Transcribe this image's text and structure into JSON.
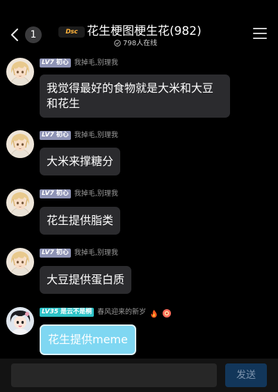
{
  "header": {
    "unread_count": "1",
    "logo_text": "Dsc one!",
    "title": "花生梗图梗生花(982)",
    "online_text": "798人在线"
  },
  "messages": [
    {
      "level": "LV7",
      "rank": "初心",
      "nickname": "我掉毛,别理我",
      "text": "我觉得最好的食物就是大米和大豆和花生"
    },
    {
      "level": "LV7",
      "rank": "初心",
      "nickname": "我掉毛,别理我",
      "text": "大米来撑糖分"
    },
    {
      "level": "LV7",
      "rank": "初心",
      "nickname": "我掉毛,别理我",
      "text": "花生提供脂类"
    },
    {
      "level": "LV7",
      "rank": "初心",
      "nickname": "我掉毛,别理我",
      "text": "大豆提供蛋白质"
    },
    {
      "level": "LV35",
      "rank": "是云不是桐",
      "nickname": "春风迎来的新岁",
      "text": "花生提供meme"
    }
  ],
  "composer": {
    "input_value": "",
    "send_label": "发送"
  },
  "colors": {
    "background": "#000000",
    "bubble": "#2b2b2e",
    "my_bubble": "#7fd7f2",
    "level_badge": "#8f94b6",
    "level_badge_high": "#2ec3c8",
    "send_button": "#12365a"
  }
}
